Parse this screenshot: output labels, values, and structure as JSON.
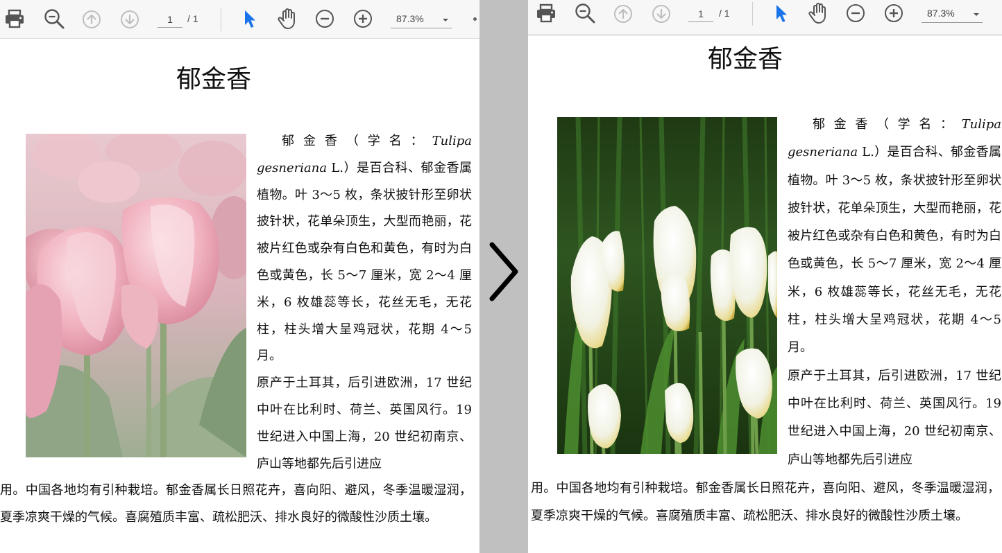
{
  "toolbar": {
    "page_current": "1",
    "page_total": "/ 1",
    "zoom": "87.3%",
    "icons": [
      "print-icon",
      "zoom-search-icon",
      "page-up-icon",
      "page-down-icon",
      "select-cursor-icon",
      "hand-tool-icon",
      "zoom-out-icon",
      "zoom-in-icon",
      "dropdown-caret-icon"
    ]
  },
  "document": {
    "title": "郁金香",
    "para1_lead": "郁金香（学名：",
    "para1_latin": "Tulipa gesneriana",
    "para1_rest": " L.）是百合科、郁金香属植物。叶 3～5 枚，条状披针形至卵状披针状，花单朵顶生，大型而艳丽，花被片红色或杂有白色和黄色，有时为白色或黄色，长 5～7 厘米，宽 2～4 厘米，6 枚雄蕊等长，花丝无毛，无花柱，柱头增大呈鸡冠状，花期 4～5 月。",
    "para2_wrap": "原产于土耳其，后引进欧洲，17 世纪中叶在比利时、荷兰、英国风行。19 世纪进入中国上海，20 世纪初南京、庐山等地都先后引进应",
    "para2_full": "用。中国各地均有引种栽培。郁金香属长日照花卉，喜向阳、避风，冬季温暖湿润，夏季凉爽干燥的气候。喜腐殖质丰富、疏松肥沃、排水良好的微酸性沙质土壤。"
  },
  "colors": {
    "toolbar_bg": "#f7f7f7",
    "select_tool_active": "#1a73e8",
    "divider_bg": "#c0c0c0",
    "icon_gray": "#555555"
  },
  "images": {
    "left": "pink-tulips-photo",
    "right": "white-tulips-photo"
  },
  "navigation": {
    "next_icon": "chevron-right-icon"
  }
}
